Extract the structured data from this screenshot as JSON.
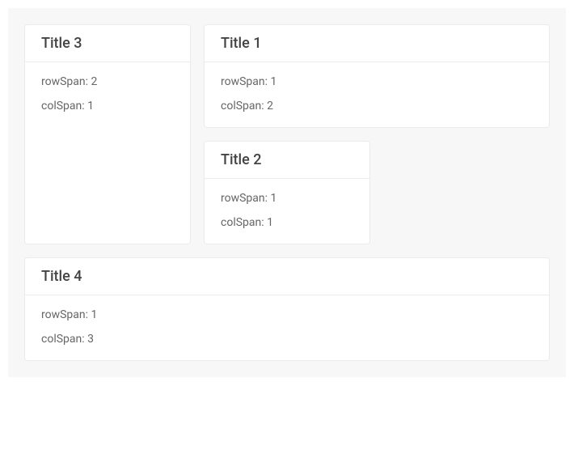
{
  "cards": [
    {
      "title": "Title 3",
      "rowSpanLabel": "rowSpan: 2",
      "colSpanLabel": "colSpan: 1"
    },
    {
      "title": "Title 1",
      "rowSpanLabel": "rowSpan: 1",
      "colSpanLabel": "colSpan: 2"
    },
    {
      "title": "Title 2",
      "rowSpanLabel": "rowSpan: 1",
      "colSpanLabel": "colSpan: 1"
    },
    {
      "title": "Title 4",
      "rowSpanLabel": "rowSpan: 1",
      "colSpanLabel": "colSpan: 3"
    }
  ]
}
